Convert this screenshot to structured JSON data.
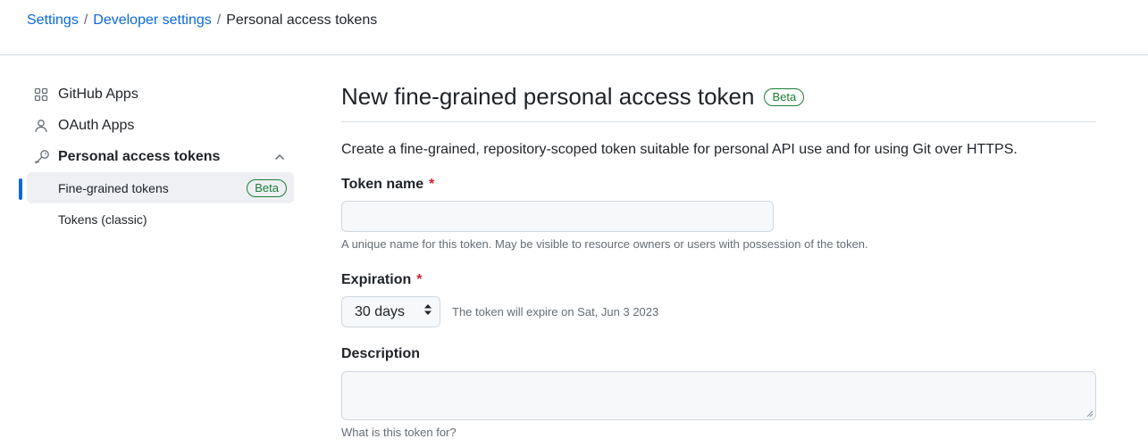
{
  "breadcrumb": {
    "items": [
      "Settings",
      "Developer settings"
    ],
    "separator": "/",
    "current": "Personal access tokens"
  },
  "sidebar": {
    "items": [
      {
        "label": "GitHub Apps",
        "icon": "apps-icon"
      },
      {
        "label": "OAuth Apps",
        "icon": "person-icon"
      },
      {
        "label": "Personal access tokens",
        "icon": "key-icon",
        "expanded": true
      }
    ],
    "sub_items": [
      {
        "label": "Fine-grained tokens",
        "badge": "Beta",
        "active": true
      },
      {
        "label": "Tokens (classic)"
      }
    ]
  },
  "main": {
    "title": "New fine-grained personal access token",
    "title_badge": "Beta",
    "intro": "Create a fine-grained, repository-scoped token suitable for personal API use and for using Git over HTTPS.",
    "token_name": {
      "label": "Token name",
      "required_mark": "*",
      "value": "",
      "note": "A unique name for this token. May be visible to resource owners or users with possession of the token."
    },
    "expiration": {
      "label": "Expiration",
      "required_mark": "*",
      "selected": "30 days",
      "note": "The token will expire on Sat, Jun 3 2023"
    },
    "description": {
      "label": "Description",
      "value": "",
      "note": "What is this token for?"
    }
  },
  "colors": {
    "link": "#0969da",
    "success": "#1a7f37",
    "danger": "#cf222e",
    "muted": "#656d76",
    "border": "#d0d7de",
    "input_bg": "#f6f8fa"
  }
}
